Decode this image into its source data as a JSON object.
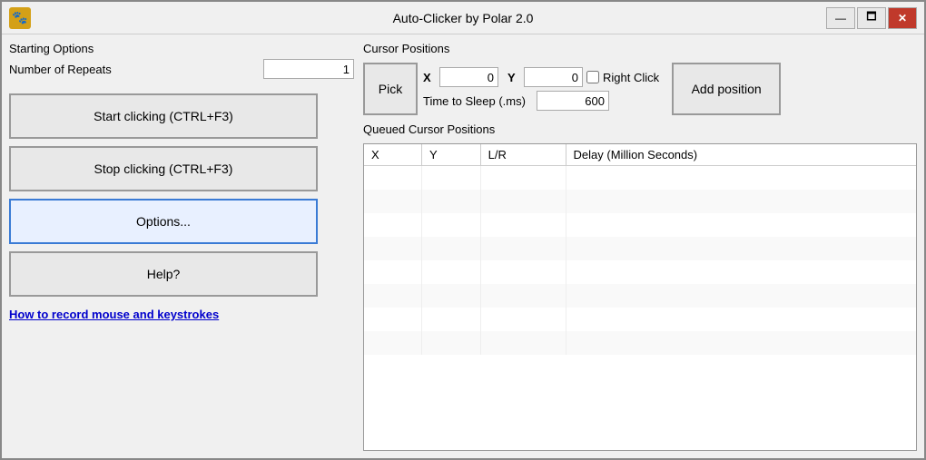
{
  "window": {
    "title": "Auto-Clicker by Polar 2.0",
    "logo": "🐾"
  },
  "titlebar": {
    "minimize_label": "—",
    "maximize_label": "🗖",
    "close_label": "✕"
  },
  "left": {
    "starting_options_label": "Starting Options",
    "repeats_label": "Number of Repeats",
    "repeats_value": "1",
    "start_btn": "Start clicking (CTRL+F3)",
    "stop_btn": "Stop clicking (CTRL+F3)",
    "options_btn": "Options...",
    "help_btn": "Help?",
    "link_text": "How to record mouse and keystrokes"
  },
  "right": {
    "cursor_positions_label": "Cursor Positions",
    "pick_btn": "Pick",
    "x_label": "X",
    "x_value": "0",
    "y_label": "Y",
    "y_value": "0",
    "right_click_label": "Right Click",
    "sleep_label": "Time to Sleep (.ms)",
    "sleep_value": "600",
    "add_position_btn": "Add position",
    "queued_label": "Queued Cursor Positions",
    "table": {
      "headers": [
        "X",
        "Y",
        "L/R",
        "Delay (Million Seconds)"
      ],
      "rows": [
        [],
        [],
        [],
        [],
        [],
        [],
        [],
        []
      ]
    }
  }
}
